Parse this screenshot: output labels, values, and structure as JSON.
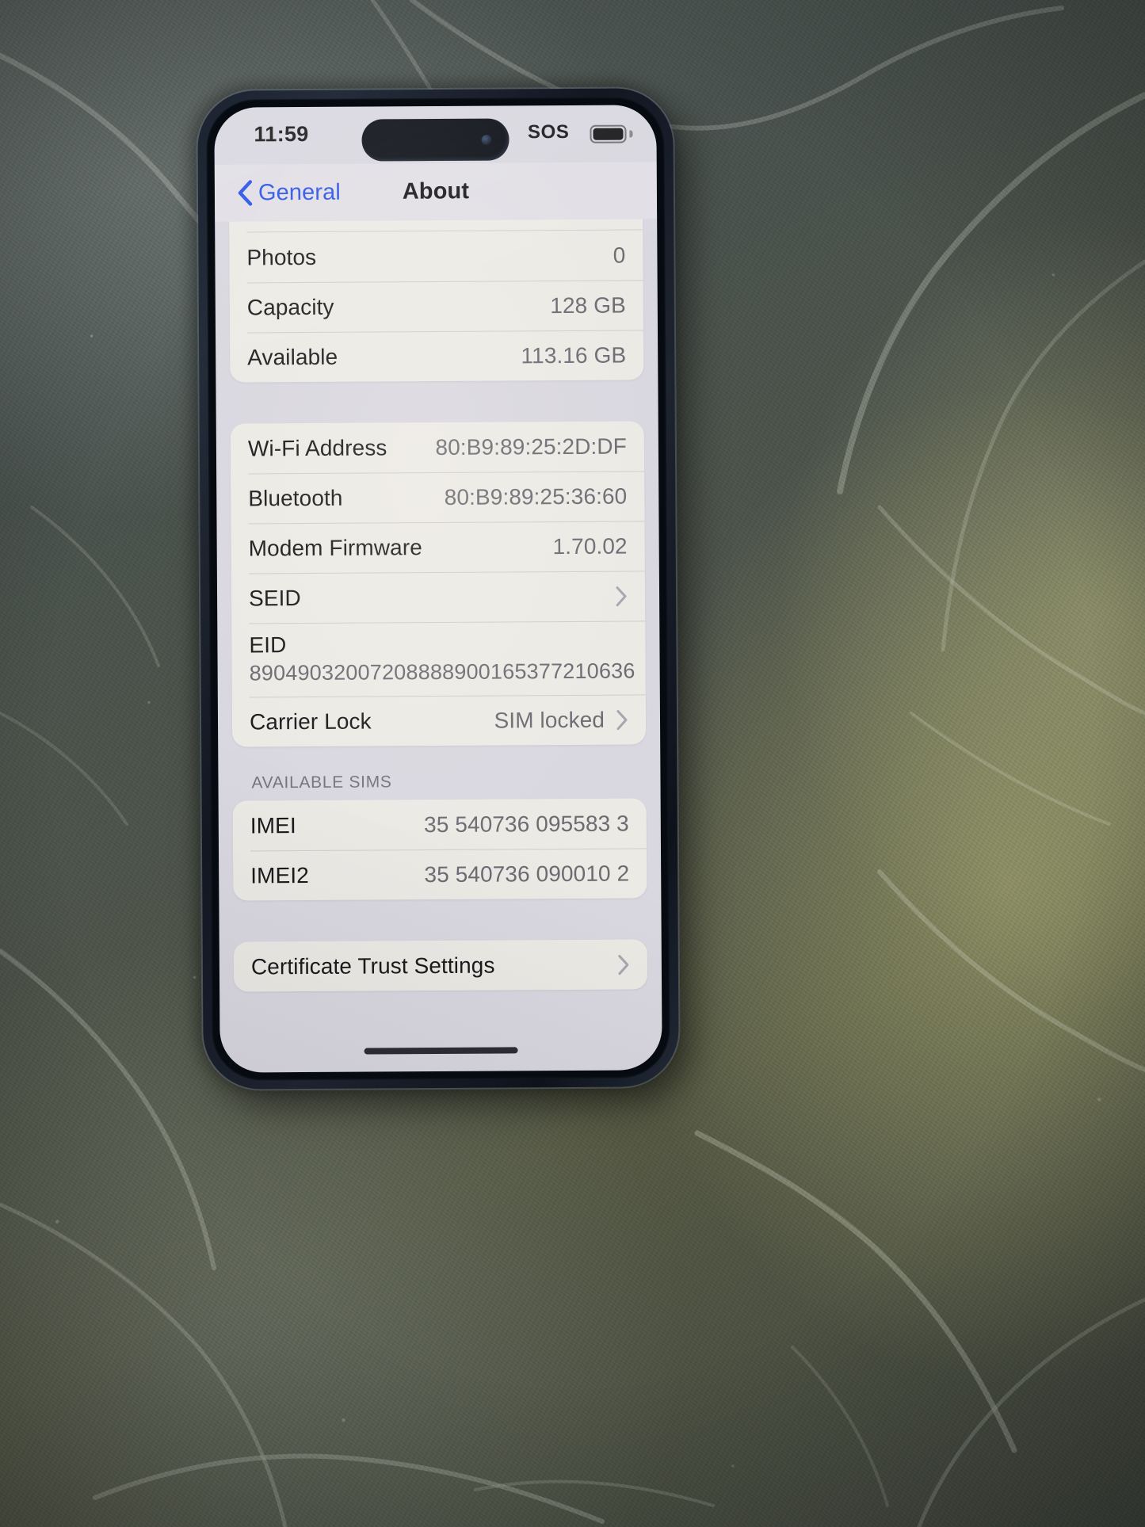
{
  "status_bar": {
    "time": "11:59",
    "sos_label": "SOS",
    "battery_icon": "battery-icon",
    "dynamic_island": "dynamic-island"
  },
  "nav": {
    "back_label": "General",
    "back_icon": "chevron-left-icon",
    "title": "About"
  },
  "colors": {
    "accent_blue": "#2b53e8",
    "card": "#eceae5",
    "page_background": "#d9d7df",
    "label": "#1a1a1c",
    "value": "#6d6a72"
  },
  "groups": [
    {
      "name": "storage-group",
      "clipped_top": true,
      "rows": [
        {
          "label": "Photos",
          "value": "0",
          "chevron": false
        },
        {
          "label": "Capacity",
          "value": "128 GB",
          "chevron": false
        },
        {
          "label": "Available",
          "value": "113.16 GB",
          "chevron": false
        }
      ]
    },
    {
      "name": "device-identifiers-group",
      "clipped_top": false,
      "rows": [
        {
          "label": "Wi-Fi Address",
          "value": "80:B9:89:25:2D:DF",
          "chevron": false
        },
        {
          "label": "Bluetooth",
          "value": "80:B9:89:25:36:60",
          "chevron": false
        },
        {
          "label": "Modem Firmware",
          "value": "1.70.02",
          "chevron": false
        },
        {
          "label": "SEID",
          "value": "",
          "chevron": true
        },
        {
          "label": "EID",
          "value": "89049032007208888900165377210636",
          "chevron": false,
          "stacked": true
        },
        {
          "label": "Carrier Lock",
          "value": "SIM locked",
          "chevron": true
        }
      ]
    },
    {
      "name": "available-sims-group",
      "header": "AVAILABLE SIMS",
      "clipped_top": false,
      "rows": [
        {
          "label": "IMEI",
          "value": "35 540736 095583 3",
          "chevron": false
        },
        {
          "label": "IMEI2",
          "value": "35 540736 090010 2",
          "chevron": false
        }
      ]
    },
    {
      "name": "certificate-group",
      "clipped_top": false,
      "rows": [
        {
          "label": "Certificate Trust Settings",
          "value": "",
          "chevron": true
        }
      ]
    }
  ]
}
